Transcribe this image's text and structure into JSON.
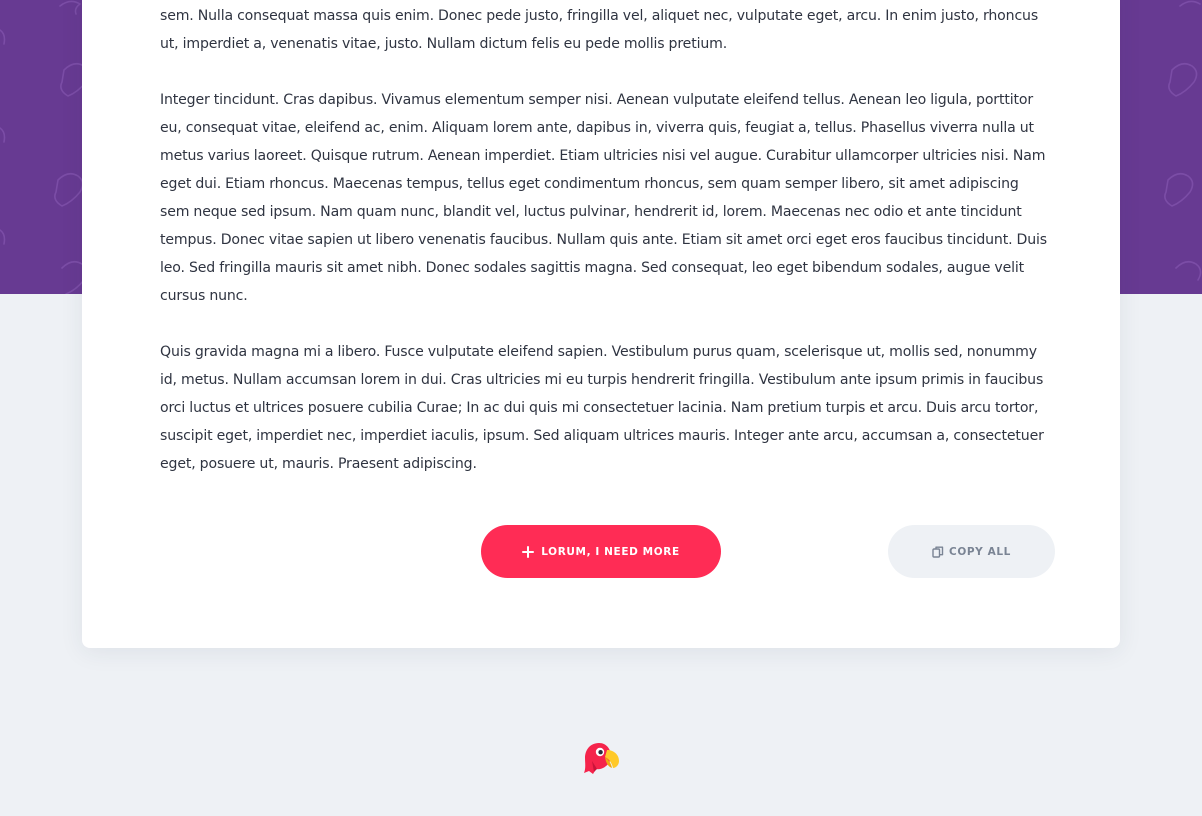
{
  "article": {
    "paragraphs": [
      "sem. Nulla consequat massa quis enim. Donec pede justo, fringilla vel, aliquet nec, vulputate eget, arcu. In enim justo, rhoncus ut, imperdiet a, venenatis vitae, justo. Nullam dictum felis eu pede mollis pretium.",
      "Integer tincidunt. Cras dapibus. Vivamus elementum semper nisi. Aenean vulputate eleifend tellus. Aenean leo ligula, porttitor eu, consequat vitae, eleifend ac, enim. Aliquam lorem ante, dapibus in, viverra quis, feugiat a, tellus. Phasellus viverra nulla ut metus varius laoreet. Quisque rutrum. Aenean imperdiet. Etiam ultricies nisi vel augue. Curabitur ullamcorper ultricies nisi. Nam eget dui. Etiam rhoncus. Maecenas tempus, tellus eget condimentum rhoncus, sem quam semper libero, sit amet adipiscing sem neque sed ipsum. Nam quam nunc, blandit vel, luctus pulvinar, hendrerit id, lorem. Maecenas nec odio et ante tincidunt tempus. Donec vitae sapien ut libero venenatis faucibus. Nullam quis ante. Etiam sit amet orci eget eros faucibus tincidunt. Duis leo. Sed fringilla mauris sit amet nibh. Donec sodales sagittis magna. Sed consequat, leo eget bibendum sodales, augue velit cursus nunc.",
      "Quis gravida magna mi a libero. Fusce vulputate eleifend sapien. Vestibulum purus quam, scelerisque ut, mollis sed, nonummy id, metus. Nullam accumsan lorem in dui. Cras ultricies mi eu turpis hendrerit fringilla. Vestibulum ante ipsum primis in faucibus orci luctus et ultrices posuere cubilia Curae; In ac dui quis mi consectetuer lacinia. Nam pretium turpis et arcu. Duis arcu tortor, suscipit eget, imperdiet nec, imperdiet iaculis, ipsum. Sed aliquam ultrices mauris. Integer ante arcu, accumsan a, consectetuer eget, posuere ut, mauris. Praesent adipiscing."
    ]
  },
  "actions": {
    "more_label": "LORUM, I NEED MORE",
    "more_icon": "plus-icon",
    "copy_label": "COPY ALL",
    "copy_icon": "copy-icon"
  },
  "footer": {
    "logo_icon": "parrot-logo"
  },
  "colors": {
    "hero_background": "#673a92",
    "page_background": "#eef1f5",
    "accent": "#ff2c55",
    "text": "#2f3441",
    "secondary_button_bg": "#eef1f5",
    "secondary_button_text": "#7a8494"
  }
}
